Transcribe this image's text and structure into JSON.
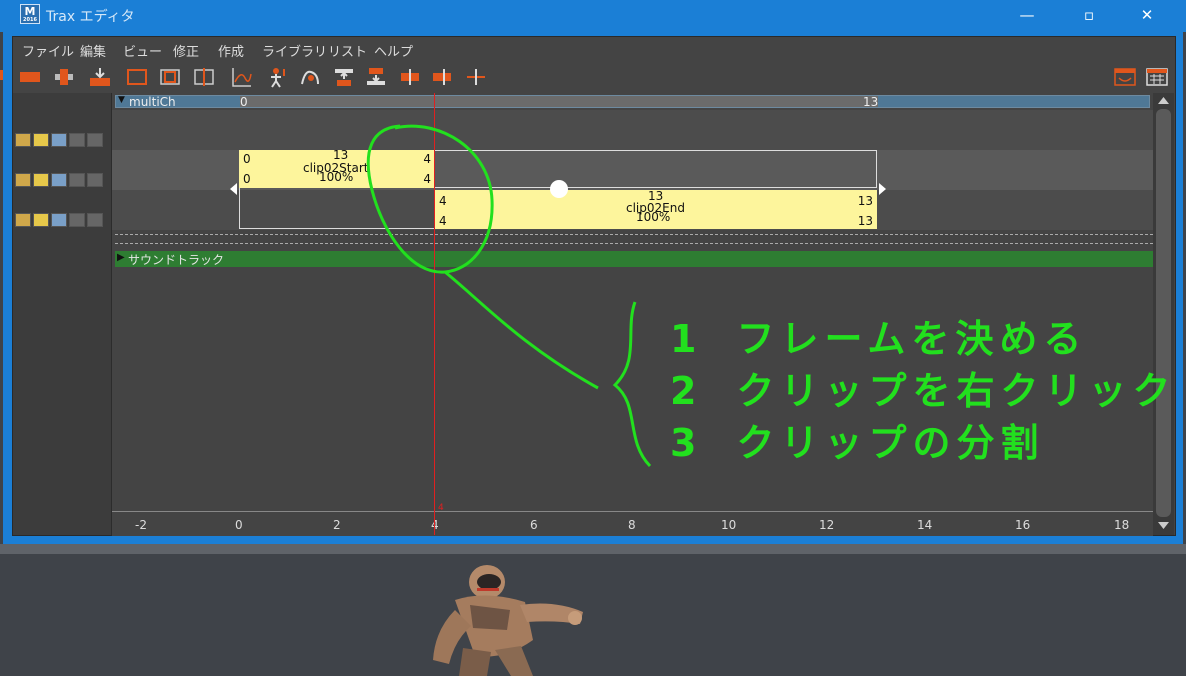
{
  "window": {
    "title": "Trax エディタ",
    "app_icon_letter": "M",
    "app_icon_sub": "2016",
    "minimize_label": "—",
    "maximize_label": "▫",
    "close_label": "✕"
  },
  "menu": [
    "ファイル",
    "編集",
    "ビュー",
    "修正",
    "作成",
    "ライブラリ",
    "リスト",
    "ヘルプ"
  ],
  "tracks": {
    "character_set": "multiCh",
    "range_start": "0",
    "range_end": "13",
    "soundtrack_label": "サウンドトラック"
  },
  "clips": {
    "start": {
      "name": "clip02Start",
      "tl": "0",
      "tr": "4",
      "bl": "0",
      "br": "4",
      "center_top": "13",
      "percent": "100%"
    },
    "end": {
      "name": "clip02End",
      "tl": "4",
      "tr": "13",
      "bl": "4",
      "br": "13",
      "center_top": "13",
      "percent": "100%"
    }
  },
  "timeline": {
    "ticks": [
      "-2",
      "0",
      "2",
      "4",
      "6",
      "8",
      "10",
      "12",
      "14",
      "16",
      "18"
    ],
    "current_frame": "4"
  },
  "annotations": {
    "color": "#22e01e",
    "lines": [
      {
        "num": "1",
        "text": "フレームを決める"
      },
      {
        "num": "2",
        "text": "クリップを右クリック"
      },
      {
        "num": "3",
        "text": "クリップの分割"
      }
    ]
  },
  "colors": {
    "title_bar": "#1b7fd6",
    "clip_fill": "#fdf59c",
    "soundtrack": "#2e7d32",
    "current_time": "#e02020",
    "character_set_bar": "#4f7896"
  }
}
